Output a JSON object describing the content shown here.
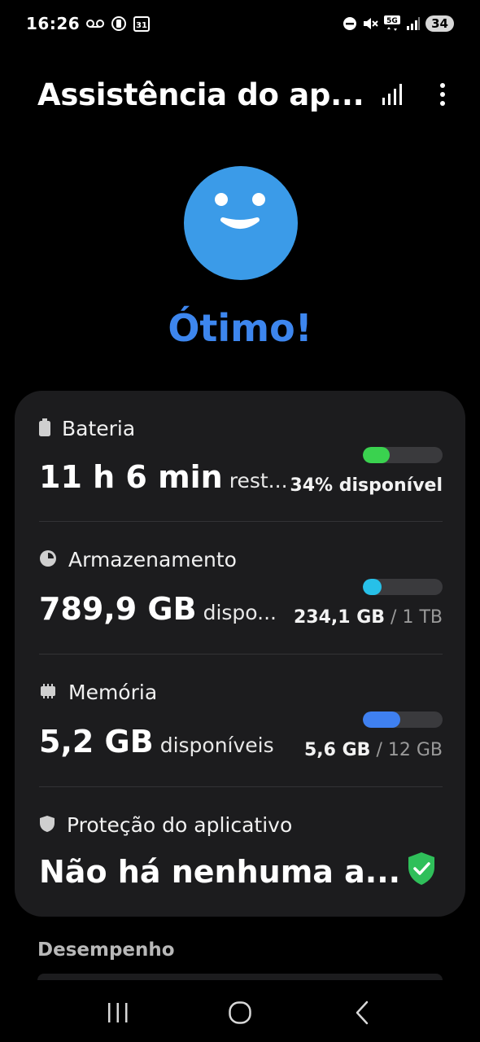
{
  "status_bar": {
    "time": "16:26",
    "calendar_day": "31",
    "network": "5G",
    "battery": "34"
  },
  "header": {
    "title": "Assistência do ap..."
  },
  "hero": {
    "status": "Ótimo!",
    "face_color": "#3b9be8"
  },
  "card": {
    "battery": {
      "title": "Bateria",
      "value": "11 h 6 min",
      "suffix": "rest...",
      "meter_fraction": 0.34,
      "meter_color": "#3ad24f",
      "detail": "34% disponível"
    },
    "storage": {
      "title": "Armazenamento",
      "value": "789,9 GB",
      "suffix": "dispo...",
      "meter_fraction": 0.234,
      "meter_color": "#27c0e8",
      "used": "234,1 GB",
      "separator": "/",
      "total": "1 TB"
    },
    "memory": {
      "title": "Memória",
      "value": "5,2 GB",
      "suffix": "disponíveis",
      "meter_fraction": 0.467,
      "meter_color": "#3f80f0",
      "used": "5,6 GB",
      "separator": "/",
      "total": "12 GB"
    },
    "protection": {
      "title": "Proteção do aplicativo",
      "value": "Não há nenhuma a...",
      "shield_color": "#2fbf5a"
    }
  },
  "performance": {
    "label": "Desempenho"
  },
  "icons": {
    "voicemail": "voicemail-icon",
    "sync": "sync-icon",
    "calendar": "calendar-icon",
    "dnd": "do-not-disturb-icon",
    "mute": "mute-icon",
    "signal": "signal-icon",
    "stats": "bar-chart-icon",
    "more": "more-vert-icon",
    "recents": "recents-icon",
    "home": "home-icon",
    "back": "back-icon"
  }
}
